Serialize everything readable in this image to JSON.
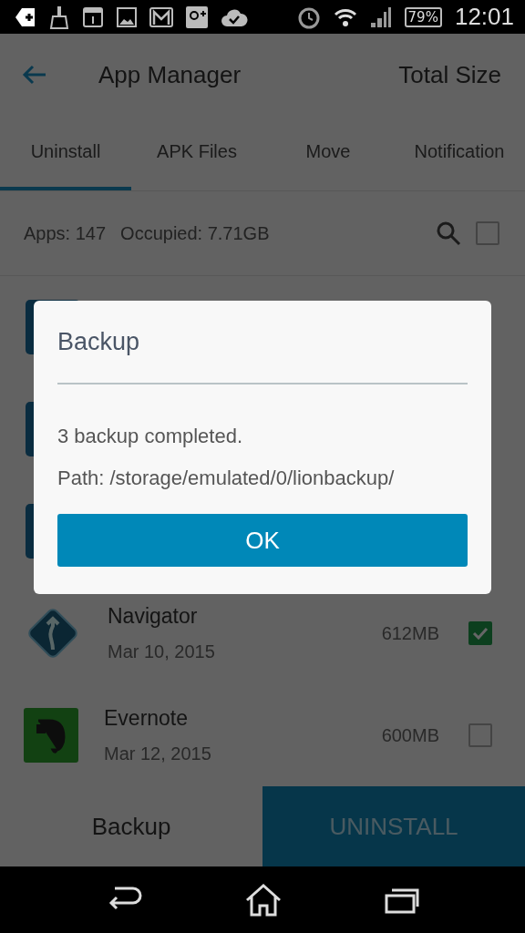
{
  "status_bar": {
    "battery": "79%",
    "time": "12:01"
  },
  "app_bar": {
    "title": "App Manager",
    "action": "Total Size"
  },
  "tabs": [
    {
      "label": "Uninstall",
      "selected": true
    },
    {
      "label": "APK Files",
      "selected": false
    },
    {
      "label": "Move",
      "selected": false
    },
    {
      "label": "Notification",
      "selected": false
    }
  ],
  "summary": {
    "apps": "Apps: 147",
    "occupied": "Occupied: 7.71GB",
    "select_all_checked": false
  },
  "apps": [
    {
      "kind": "covered"
    },
    {
      "kind": "covered"
    },
    {
      "kind": "covered"
    },
    {
      "kind": "navigator",
      "name": "Navigator",
      "date": "Mar 10, 2015",
      "size": "612MB",
      "checked": true
    },
    {
      "kind": "evernote",
      "name": "Evernote",
      "date": "Mar 12, 2015",
      "size": "600MB",
      "checked": false
    }
  ],
  "bottom_bar": {
    "secondary": "Backup",
    "primary": "UNINSTALL"
  },
  "dialog": {
    "title": "Backup",
    "message": "3 backup completed.",
    "path": "Path: /storage/emulated/0/lionbackup/",
    "button": "OK"
  }
}
